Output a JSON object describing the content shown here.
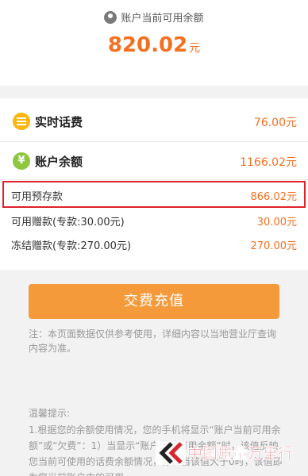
{
  "header": {
    "balance_label": "账户当前可用余额",
    "balance_value": "820.02",
    "balance_unit": "元"
  },
  "summary": {
    "realtime_fee_label": "实时话费",
    "realtime_fee_value": "76.00元",
    "account_balance_label": "账户余额",
    "account_balance_value": "1166.02元"
  },
  "details": [
    {
      "label": "可用预存款",
      "value": "866.02元"
    },
    {
      "label": "可用赠款(专款:30.00元)",
      "value": "30.00元"
    },
    {
      "label": "冻结赠款(专款:270.00元)",
      "value": "270.00元"
    }
  ],
  "recharge_button": "交费充值",
  "notice": "注：本页面数据仅供参考使用，详细内容以当地营业厅查询内容为准。",
  "tips": {
    "title": "温馨提示:",
    "body": "1.根据您的余额使用情况，您的手机将显示“账户当前可用余额”或“欠费”：1）当显示“账户当前可用余额”时，该值反映您当前可使用的话费余额情况，即：当该值大于0时，该值即为您当前账户中的可用"
  },
  "watermark": {
    "text": "中国质量万里行"
  },
  "colors": {
    "accent": "#f37021",
    "button": "#f59a3a",
    "highlight": "#e0212b"
  },
  "icons": {
    "header": "user-group-icon",
    "realtime_fee": "coin-stack-icon",
    "account_balance": "yen-icon"
  }
}
